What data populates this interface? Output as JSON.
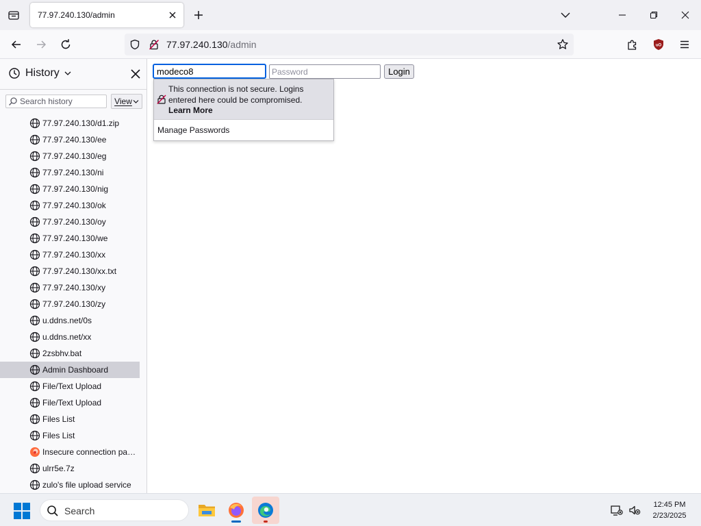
{
  "browser": {
    "tab_title": "77.97.240.130/admin",
    "url_host": "77.97.240.130",
    "url_path": "/admin"
  },
  "sidebar": {
    "title": "History",
    "search_placeholder": "Search history",
    "view_label": "View",
    "items": [
      {
        "label": "77.97.240.130/d1.zip",
        "icon": "globe-icon"
      },
      {
        "label": "77.97.240.130/ee",
        "icon": "globe-icon"
      },
      {
        "label": "77.97.240.130/eg",
        "icon": "globe-icon"
      },
      {
        "label": "77.97.240.130/ni",
        "icon": "globe-icon"
      },
      {
        "label": "77.97.240.130/nig",
        "icon": "globe-icon"
      },
      {
        "label": "77.97.240.130/ok",
        "icon": "globe-icon"
      },
      {
        "label": "77.97.240.130/oy",
        "icon": "globe-icon"
      },
      {
        "label": "77.97.240.130/we",
        "icon": "globe-icon"
      },
      {
        "label": "77.97.240.130/xx",
        "icon": "globe-icon"
      },
      {
        "label": "77.97.240.130/xx.txt",
        "icon": "globe-icon"
      },
      {
        "label": "77.97.240.130/xy",
        "icon": "globe-icon"
      },
      {
        "label": "77.97.240.130/zy",
        "icon": "globe-icon"
      },
      {
        "label": "u.ddns.net/0s",
        "icon": "globe-icon"
      },
      {
        "label": "u.ddns.net/xx",
        "icon": "globe-icon"
      },
      {
        "label": "2zsbhv.bat",
        "icon": "globe-icon"
      },
      {
        "label": "Admin Dashboard",
        "icon": "globe-icon",
        "selected": true
      },
      {
        "label": "File/Text Upload",
        "icon": "globe-icon"
      },
      {
        "label": "File/Text Upload",
        "icon": "globe-icon"
      },
      {
        "label": "Files List",
        "icon": "globe-icon"
      },
      {
        "label": "Files List",
        "icon": "globe-icon"
      },
      {
        "label": "Insecure connection pass...",
        "icon": "firefox-warning-icon"
      },
      {
        "label": "ulrr5e.7z",
        "icon": "globe-icon"
      },
      {
        "label": "zulo's file upload service",
        "icon": "globe-icon"
      }
    ]
  },
  "login": {
    "username_value": "modeco8",
    "password_placeholder": "Password",
    "login_label": "Login"
  },
  "password_popup": {
    "warning_text": "This connection is not secure. Logins entered here could be compromised.",
    "learn_more": "Learn More",
    "manage_passwords": "Manage Passwords"
  },
  "taskbar": {
    "search_label": "Search",
    "time": "12:45 PM",
    "date": "2/23/2025"
  },
  "colors": {
    "focus_blue": "#0060df",
    "selected_row": "#d0d0d7",
    "ublock_red": "#9b1c1c"
  }
}
